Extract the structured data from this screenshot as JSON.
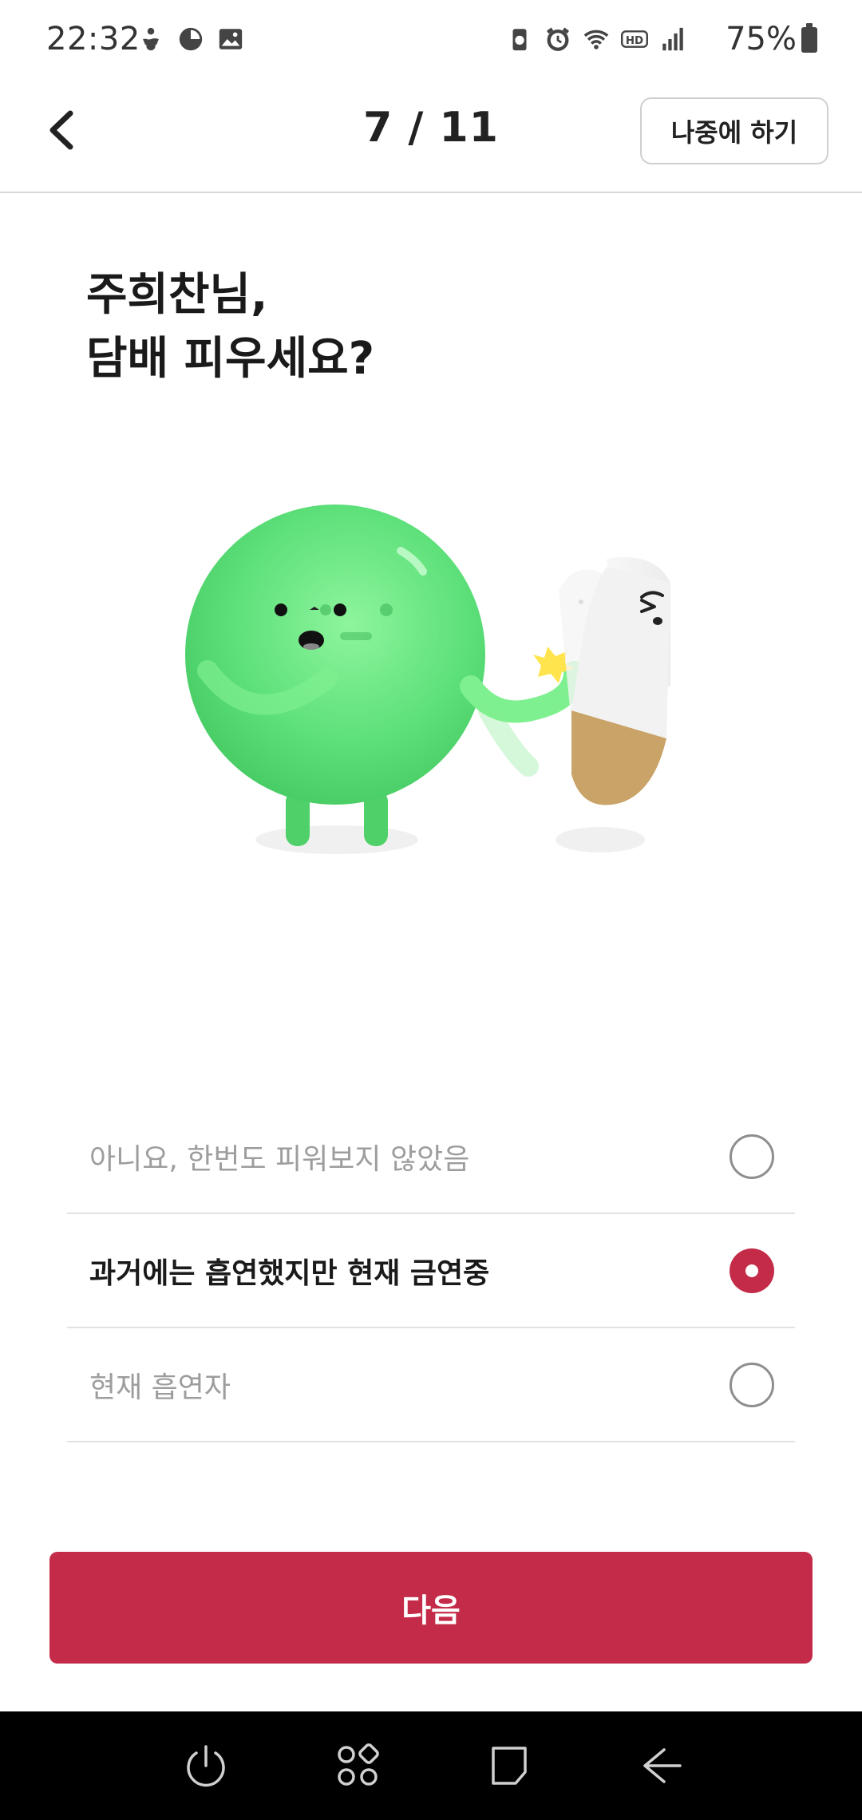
{
  "status_bar": {
    "time": "22:32",
    "battery": "75%",
    "icons_left": [
      "accessibility-icon",
      "pie-icon",
      "image-icon"
    ],
    "icons_right": [
      "battery-saver-icon",
      "alarm-icon",
      "wifi-icon",
      "hd-icon",
      "signal-icon"
    ]
  },
  "header": {
    "step": "7 / 11",
    "later_label": "나중에 하기"
  },
  "question": {
    "line1": "주희찬님,",
    "line2": "담배 피우세요?"
  },
  "options": [
    {
      "label": "아니요, 한번도 피워보지 않았음",
      "selected": false
    },
    {
      "label": "과거에는 흡연했지만 현재 금연중",
      "selected": true
    },
    {
      "label": "현재 흡연자",
      "selected": false
    }
  ],
  "next_label": "다음",
  "colors": {
    "accent": "#c42b49",
    "character_green": "#5de07a",
    "nav_background": "#000000"
  }
}
